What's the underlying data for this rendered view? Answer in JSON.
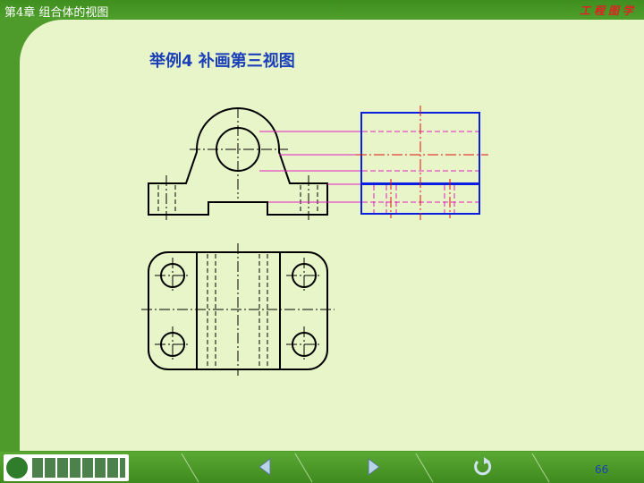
{
  "header": {
    "chapter": "第4章  组合体的视图",
    "course": "工程图学"
  },
  "main": {
    "title": "举例4  补画第三视图"
  },
  "footer": {
    "page_number": "66",
    "logo_icon": "university-logo-icon",
    "prev_icon": "triangle-left-icon",
    "next_icon": "triangle-right-icon",
    "return_icon": "return-arrow-icon"
  },
  "colors": {
    "frame_green": "#4e9a2a",
    "content_bg": "#e7f5c9",
    "title_blue": "#1a3fb8",
    "outline_black": "#000000",
    "projection_magenta": "#e020c0",
    "answer_blue": "#0a1fe0",
    "answer_red": "#e01010"
  }
}
